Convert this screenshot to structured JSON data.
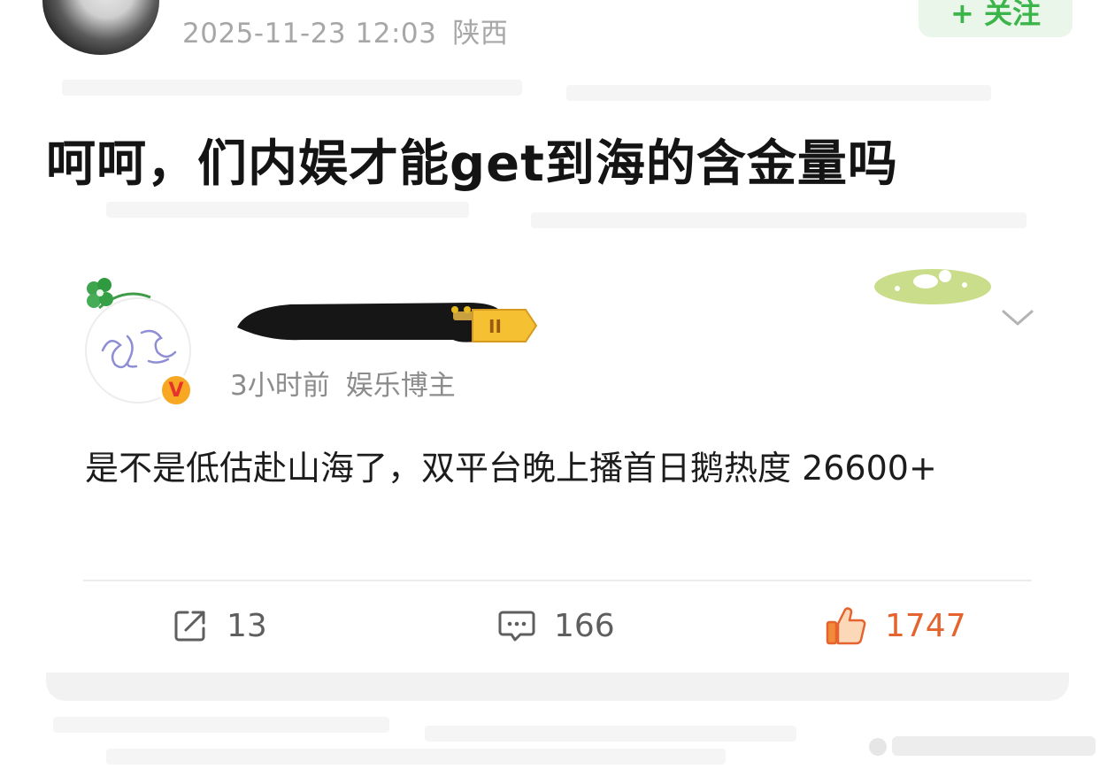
{
  "post": {
    "timestamp": "2025-11-23 12:03",
    "location": "陕西",
    "follow_label": "+ 关注",
    "title": "呵呵，们内娱才能get到海的含金量吗"
  },
  "quoted": {
    "meta_time": "3小时前",
    "meta_role": "娱乐博主",
    "badge_letter": "V",
    "text": "是不是低估赴山海了，双平台晚上播首日鹅热度 26600+",
    "actions": {
      "share_count": "13",
      "comment_count": "166",
      "like_count": "1747"
    }
  },
  "colors": {
    "follow_green": "#3bb54a",
    "like_orange": "#e5632e",
    "meta_gray": "#a7a7a7"
  },
  "icons": [
    "share-icon",
    "comment-icon",
    "like-icon",
    "clover-icon",
    "chevron-down-icon",
    "verified-badge-icon"
  ]
}
